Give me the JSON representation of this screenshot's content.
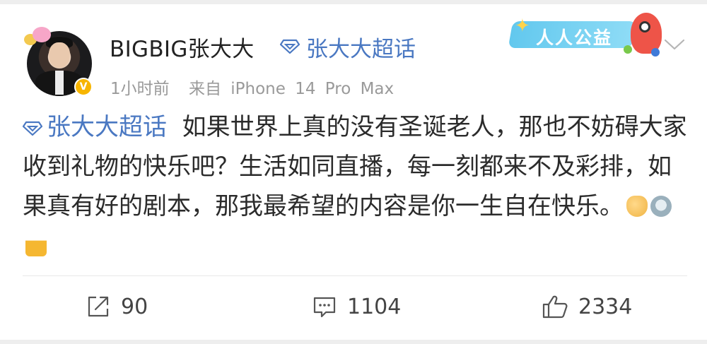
{
  "header": {
    "username": "BIGBIG张大大",
    "super_topic_link": "张大大超话",
    "meta": {
      "time": "1小时前",
      "source": "来自 iPhone 14 Pro Max"
    },
    "promo_badge": "人人公益",
    "verified_badge": "V"
  },
  "post": {
    "topic": "张大大超话",
    "text": "如果世界上真的没有圣诞老人，那也不妨碍大家收到礼物的快乐吧？生活如同直播，每一刻都来不及彩排，如果真有好的剧本，那我最希望的内容是你一生自在快乐。"
  },
  "actions": {
    "repost_count": "90",
    "comment_count": "1104",
    "like_count": "2334"
  },
  "colors": {
    "link_blue": "#4a78c2",
    "meta_gray": "#9a9a9a",
    "text": "#2b2b2b",
    "promo_blue": "#62c8ee"
  },
  "icons": [
    "diamond-icon",
    "chevron-down-icon",
    "repost-icon",
    "comment-icon",
    "like-icon"
  ]
}
